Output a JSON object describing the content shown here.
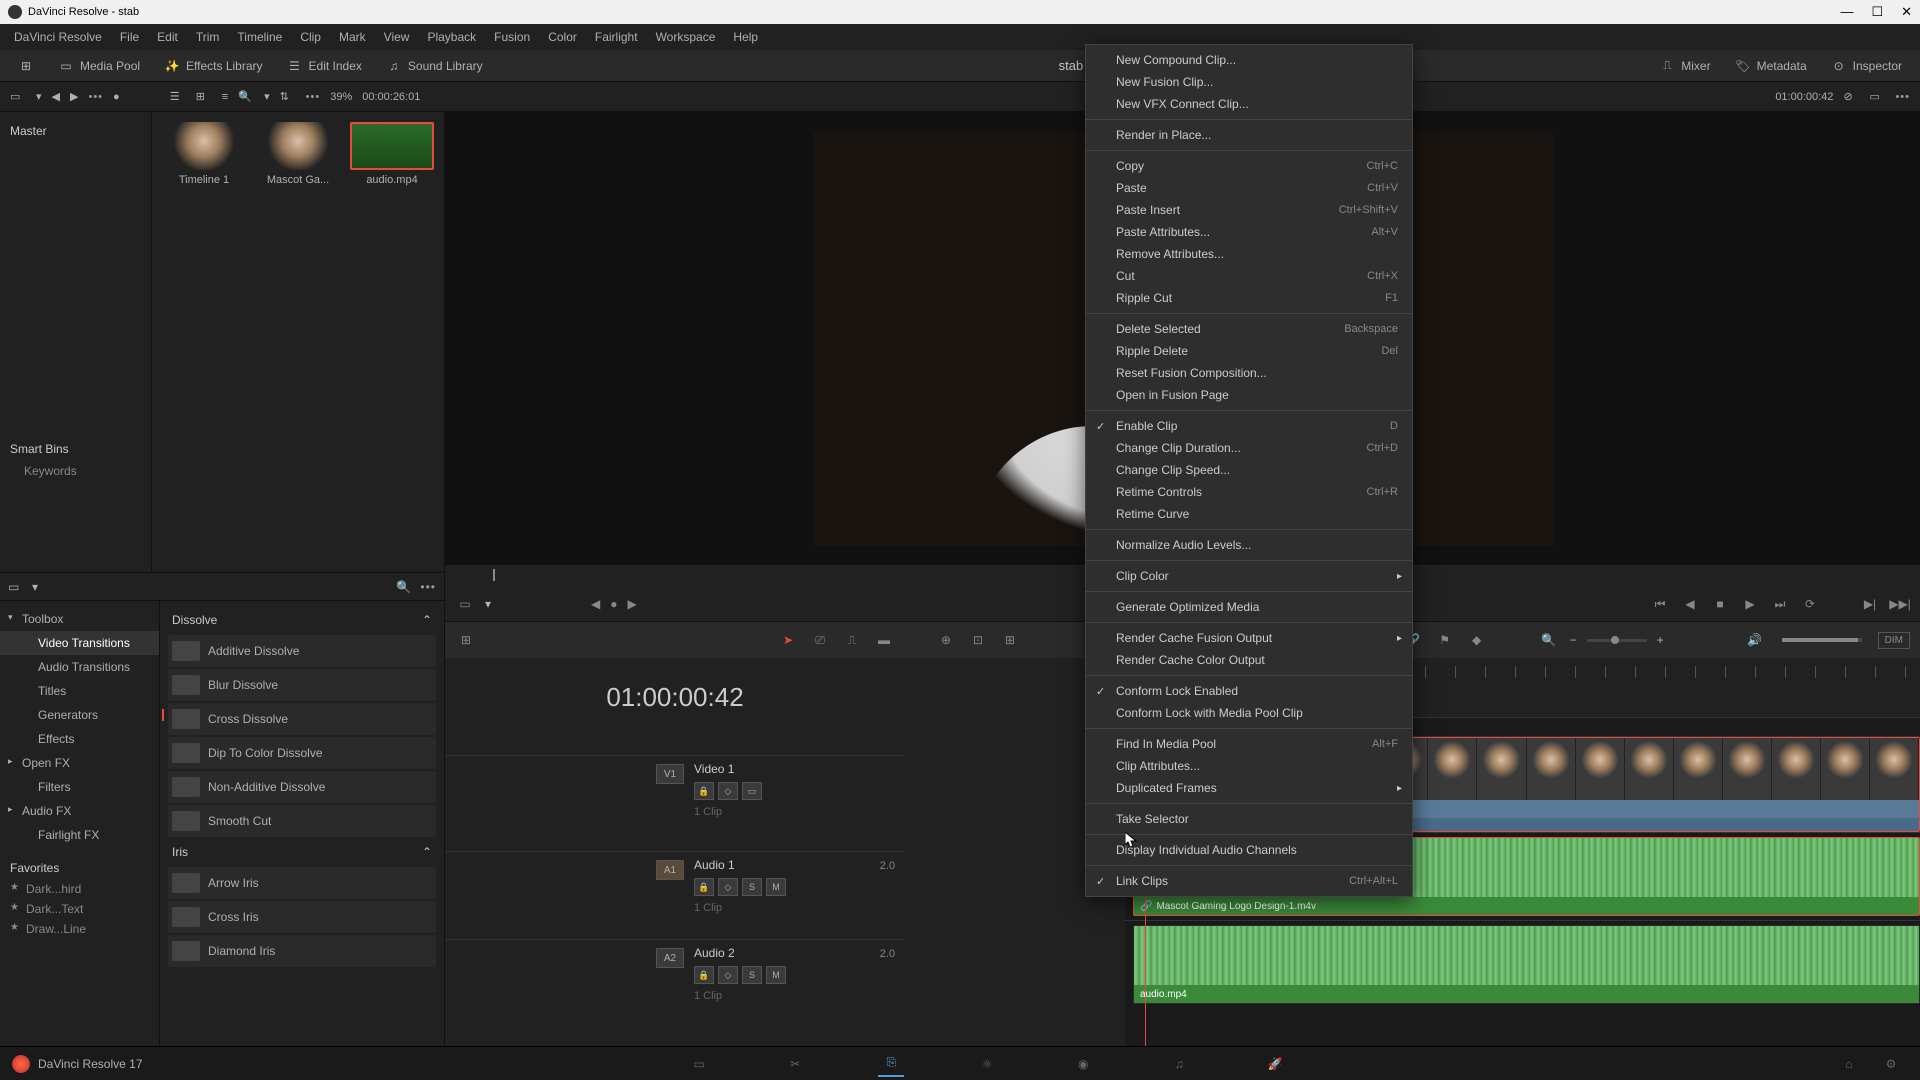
{
  "window": {
    "title": "DaVinci Resolve - stab"
  },
  "menubar": [
    "DaVinci Resolve",
    "File",
    "Edit",
    "Trim",
    "Timeline",
    "Clip",
    "Mark",
    "View",
    "Playback",
    "Fusion",
    "Color",
    "Fairlight",
    "Workspace",
    "Help"
  ],
  "top_toolbar": {
    "media_pool": "Media Pool",
    "effects_library": "Effects Library",
    "edit_index": "Edit Index",
    "sound_library": "Sound Library",
    "mixer": "Mixer",
    "metadata": "Metadata",
    "inspector": "Inspector",
    "project_title": "stab"
  },
  "sec_toolbar": {
    "zoom": "39%",
    "timecode_src": "00:00:26:01",
    "timecode_rec": "01:00:00:42"
  },
  "bins": {
    "master": "Master",
    "smart_bins": "Smart Bins",
    "keywords": "Keywords"
  },
  "clips": [
    {
      "name": "Timeline 1"
    },
    {
      "name": "Mascot Ga..."
    },
    {
      "name": "audio.mp4"
    }
  ],
  "fx_tree": {
    "toolbox": "Toolbox",
    "video_transitions": "Video Transitions",
    "audio_transitions": "Audio Transitions",
    "titles": "Titles",
    "generators": "Generators",
    "effects": "Effects",
    "open_fx": "Open FX",
    "filters": "Filters",
    "audio_fx": "Audio FX",
    "fairlight_fx": "Fairlight FX",
    "favorites": "Favorites",
    "fav_items": [
      "Dark...hird",
      "Dark...Text",
      "Draw...Line"
    ]
  },
  "fx_list": {
    "dissolve": "Dissolve",
    "dissolve_items": [
      "Additive Dissolve",
      "Blur Dissolve",
      "Cross Dissolve",
      "Dip To Color Dissolve",
      "Non-Additive Dissolve",
      "Smooth Cut"
    ],
    "iris": "Iris",
    "iris_items": [
      "Arrow Iris",
      "Cross Iris",
      "Diamond Iris"
    ]
  },
  "timeline": {
    "timecode": "01:00:00:42",
    "v1": {
      "tag": "V1",
      "name": "Video 1",
      "clips": "1 Clip"
    },
    "a1": {
      "tag": "A1",
      "name": "Audio 1",
      "ch": "2.0",
      "clips": "1 Clip"
    },
    "a2": {
      "tag": "A2",
      "name": "Audio 2",
      "ch": "2.0",
      "clips": "1 Clip"
    },
    "clip_v1": "Mascot Gaming Logo Design-1.m4v",
    "clip_a1": "Mascot Gaming Logo Design-1.m4v",
    "clip_a2": "audio.mp4",
    "dim": "DIM"
  },
  "context_menu": [
    {
      "label": "New Compound Clip...",
      "type": "item"
    },
    {
      "label": "New Fusion Clip...",
      "type": "item"
    },
    {
      "label": "New VFX Connect Clip...",
      "type": "item"
    },
    {
      "type": "sep"
    },
    {
      "label": "Render in Place...",
      "type": "item"
    },
    {
      "type": "sep"
    },
    {
      "label": "Copy",
      "shortcut": "Ctrl+C",
      "type": "item"
    },
    {
      "label": "Paste",
      "shortcut": "Ctrl+V",
      "type": "item"
    },
    {
      "label": "Paste Insert",
      "shortcut": "Ctrl+Shift+V",
      "type": "item"
    },
    {
      "label": "Paste Attributes...",
      "shortcut": "Alt+V",
      "type": "item"
    },
    {
      "label": "Remove Attributes...",
      "type": "item"
    },
    {
      "label": "Cut",
      "shortcut": "Ctrl+X",
      "type": "item"
    },
    {
      "label": "Ripple Cut",
      "shortcut": "F1",
      "type": "item"
    },
    {
      "type": "sep"
    },
    {
      "label": "Delete Selected",
      "shortcut": "Backspace",
      "type": "item"
    },
    {
      "label": "Ripple Delete",
      "shortcut": "Del",
      "type": "item"
    },
    {
      "label": "Reset Fusion Composition...",
      "type": "item"
    },
    {
      "label": "Open in Fusion Page",
      "type": "item"
    },
    {
      "type": "sep"
    },
    {
      "label": "Enable Clip",
      "shortcut": "D",
      "type": "item",
      "checked": true
    },
    {
      "label": "Change Clip Duration...",
      "shortcut": "Ctrl+D",
      "type": "item"
    },
    {
      "label": "Change Clip Speed...",
      "type": "item"
    },
    {
      "label": "Retime Controls",
      "shortcut": "Ctrl+R",
      "type": "item"
    },
    {
      "label": "Retime Curve",
      "type": "item"
    },
    {
      "type": "sep"
    },
    {
      "label": "Normalize Audio Levels...",
      "type": "item"
    },
    {
      "type": "sep"
    },
    {
      "label": "Clip Color",
      "type": "sub"
    },
    {
      "type": "sep"
    },
    {
      "label": "Generate Optimized Media",
      "type": "item"
    },
    {
      "type": "sep"
    },
    {
      "label": "Render Cache Fusion Output",
      "type": "sub"
    },
    {
      "label": "Render Cache Color Output",
      "type": "item"
    },
    {
      "type": "sep"
    },
    {
      "label": "Conform Lock Enabled",
      "type": "item",
      "checked": true
    },
    {
      "label": "Conform Lock with Media Pool Clip",
      "type": "item"
    },
    {
      "type": "sep"
    },
    {
      "label": "Find In Media Pool",
      "shortcut": "Alt+F",
      "type": "item"
    },
    {
      "label": "Clip Attributes...",
      "type": "item"
    },
    {
      "label": "Duplicated Frames",
      "type": "sub"
    },
    {
      "type": "sep"
    },
    {
      "label": "Take Selector",
      "type": "item"
    },
    {
      "type": "sep"
    },
    {
      "label": "Display Individual Audio Channels",
      "type": "item"
    },
    {
      "type": "sep"
    },
    {
      "label": "Link Clips",
      "shortcut": "Ctrl+Alt+L",
      "type": "item",
      "checked": true
    }
  ],
  "page_nav": {
    "app": "DaVinci Resolve 17"
  }
}
